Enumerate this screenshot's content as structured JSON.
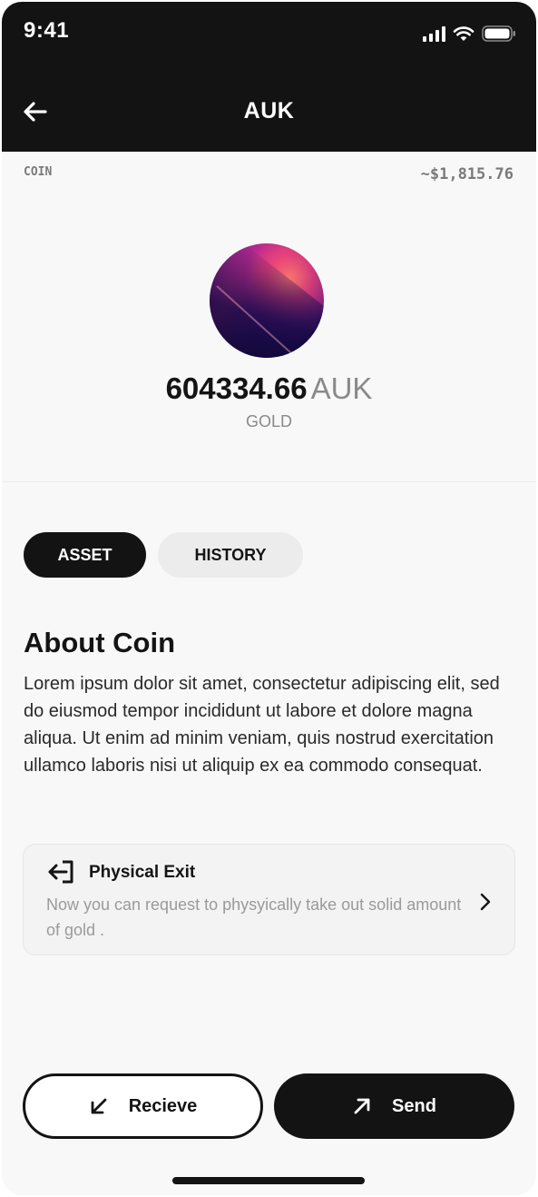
{
  "status_bar": {
    "time": "9:41"
  },
  "header": {
    "title": "AUK"
  },
  "coin_info": {
    "label": "COIN",
    "fiat_value": "~$1,815.76"
  },
  "balance": {
    "amount": "604334.66",
    "unit": "AUK",
    "type": "GOLD"
  },
  "tabs": [
    {
      "label": "ASSET",
      "active": true
    },
    {
      "label": "HISTORY",
      "active": false
    }
  ],
  "about": {
    "title": "About Coin",
    "text": "Lorem ipsum dolor sit amet, consectetur adipiscing elit, sed do eiusmod tempor incididunt ut labore et dolore magna aliqua. Ut enim ad minim veniam, quis nostrud exercitation ullamco laboris nisi ut aliquip ex ea commodo consequat."
  },
  "physical_exit": {
    "title": "Physical Exit",
    "description": "Now you can request to  physyically take out solid amount of gold .",
    "icon": "exit-icon"
  },
  "actions": {
    "receive_label": "Recieve",
    "send_label": "Send"
  },
  "colors": {
    "dark": "#131313",
    "muted": "#8a8a8a",
    "background": "#f8f8f8"
  }
}
